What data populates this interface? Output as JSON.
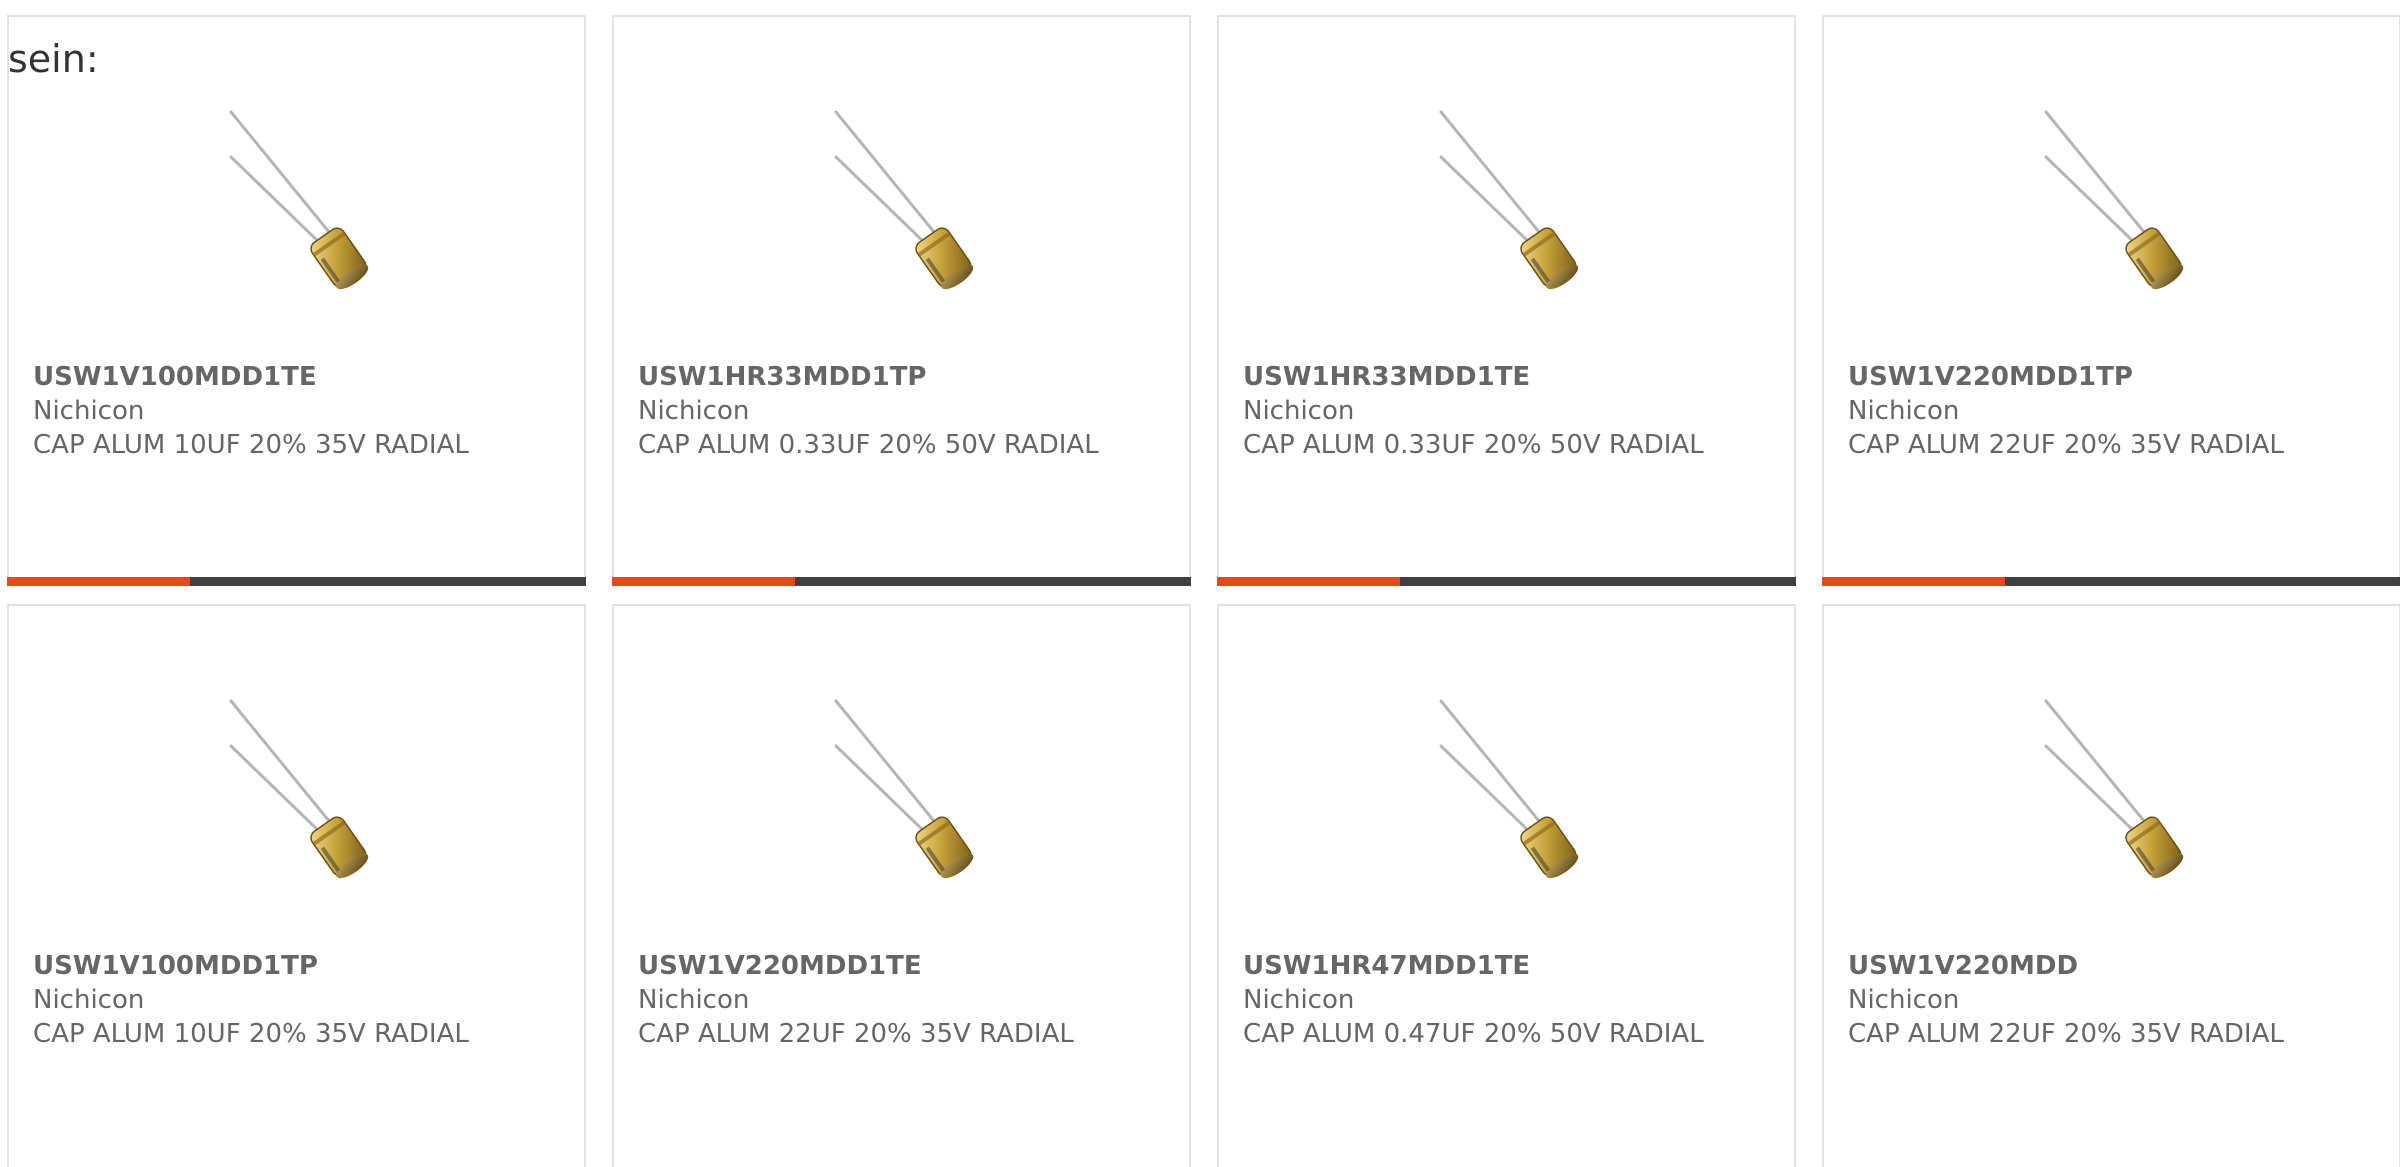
{
  "intro_text": "sein:",
  "colors": {
    "accent": "#e4481b",
    "bar": "#3f3f3f",
    "text": "#666666",
    "border": "#e2e2e2"
  },
  "products": [
    {
      "part_number": "USW1V100MDD1TE",
      "manufacturer": "Nichicon",
      "description": "CAP ALUM 10UF 20% 35V RADIAL",
      "image": "capacitor-icon"
    },
    {
      "part_number": "USW1HR33MDD1TP",
      "manufacturer": "Nichicon",
      "description": "CAP ALUM 0.33UF 20% 50V RADIAL",
      "image": "capacitor-icon"
    },
    {
      "part_number": "USW1HR33MDD1TE",
      "manufacturer": "Nichicon",
      "description": "CAP ALUM 0.33UF 20% 50V RADIAL",
      "image": "capacitor-icon"
    },
    {
      "part_number": "USW1V220MDD1TP",
      "manufacturer": "Nichicon",
      "description": "CAP ALUM 22UF 20% 35V RADIAL",
      "image": "capacitor-icon"
    },
    {
      "part_number": "USW1V100MDD1TP",
      "manufacturer": "Nichicon",
      "description": "CAP ALUM 10UF 20% 35V RADIAL",
      "image": "capacitor-icon"
    },
    {
      "part_number": "USW1V220MDD1TE",
      "manufacturer": "Nichicon",
      "description": "CAP ALUM 22UF 20% 35V RADIAL",
      "image": "capacitor-icon"
    },
    {
      "part_number": "USW1HR47MDD1TE",
      "manufacturer": "Nichicon",
      "description": "CAP ALUM 0.47UF 20% 50V RADIAL",
      "image": "capacitor-icon"
    },
    {
      "part_number": "USW1V220MDD",
      "manufacturer": "Nichicon",
      "description": "CAP ALUM 22UF 20% 35V RADIAL",
      "image": "capacitor-icon"
    }
  ]
}
